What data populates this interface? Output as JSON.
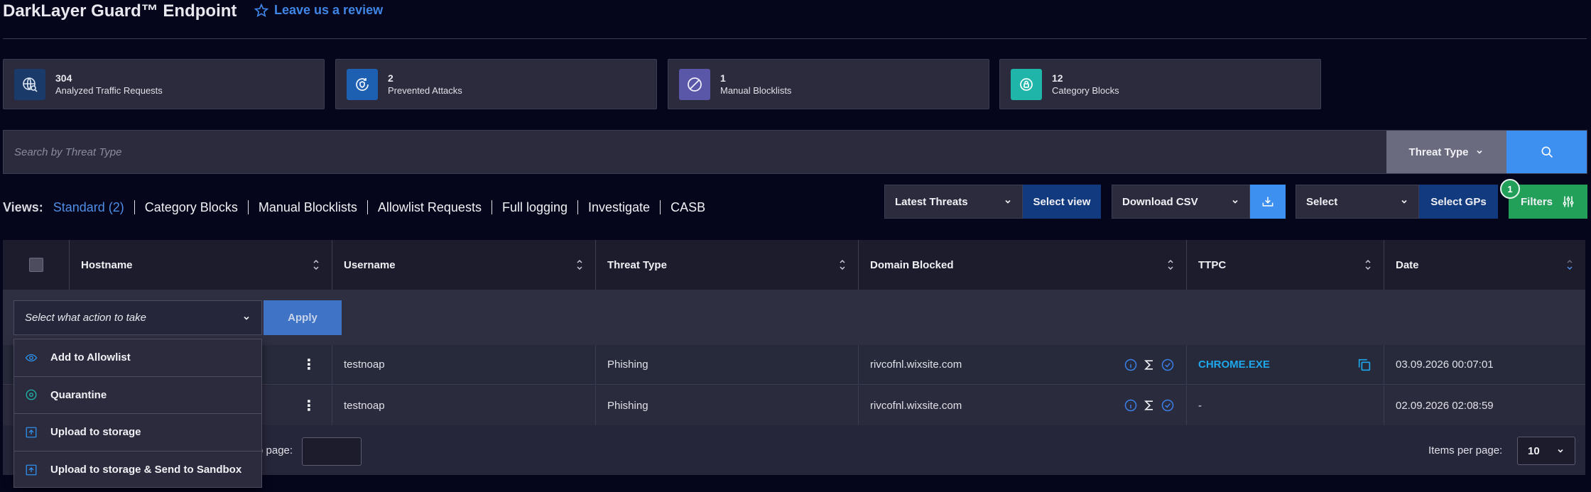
{
  "header": {
    "title": "DarkLayer Guard™ Endpoint",
    "review_link": "Leave us a review"
  },
  "stats": [
    {
      "value": "304",
      "label": "Analyzed Traffic Requests",
      "icon": "globe-search-icon",
      "color": "#1a3a6a"
    },
    {
      "value": "2",
      "label": "Prevented Attacks",
      "icon": "shield-refresh-icon",
      "color": "#1d5fb0"
    },
    {
      "value": "1",
      "label": "Manual Blocklists",
      "icon": "blocked-icon",
      "color": "#5a57a8"
    },
    {
      "value": "12",
      "label": "Category Blocks",
      "icon": "lock-category-icon",
      "color": "#1fb5a8"
    }
  ],
  "search": {
    "placeholder": "Search by Threat Type",
    "filter_label": "Threat Type"
  },
  "views": {
    "label": "Views:",
    "tabs": [
      "Standard (2)",
      "Category Blocks",
      "Manual Blocklists",
      "Allowlist Requests",
      "Full logging",
      "Investigate",
      "CASB"
    ]
  },
  "toolbar": {
    "view_select": "Latest Threats",
    "select_view_btn": "Select view",
    "download_select": "Download CSV",
    "gp_select": "Select",
    "select_gps_btn": "Select GPs",
    "filters_btn": "Filters",
    "filter_count": "1"
  },
  "table": {
    "columns": [
      "Hostname",
      "Username",
      "Threat Type",
      "Domain Blocked",
      "TTPC",
      "Date"
    ],
    "action_placeholder": "Select what action to take",
    "apply_label": "Apply",
    "rows": [
      {
        "username": "testnoap",
        "threat": "Phishing",
        "domain": "rivcofnl.wixsite.com",
        "ttpc": "CHROME.EXE",
        "date": "03.09.2026  00:07:01"
      },
      {
        "username": "testnoap",
        "threat": "Phishing",
        "domain": "rivcofnl.wixsite.com",
        "ttpc": "-",
        "date": "02.09.2026  02:08:59"
      }
    ]
  },
  "pagination": {
    "go_label": "o page:",
    "items_per_page_label": "Items per page:",
    "items_per_page": "10"
  },
  "action_menu": [
    {
      "label": "Add to Allowlist",
      "icon": "eye-allow-icon"
    },
    {
      "label": "Quarantine",
      "icon": "quarantine-icon"
    },
    {
      "label": "Upload to storage",
      "icon": "upload-icon"
    },
    {
      "label": "Upload to storage & Send to Sandbox",
      "icon": "upload-sandbox-icon"
    }
  ]
}
